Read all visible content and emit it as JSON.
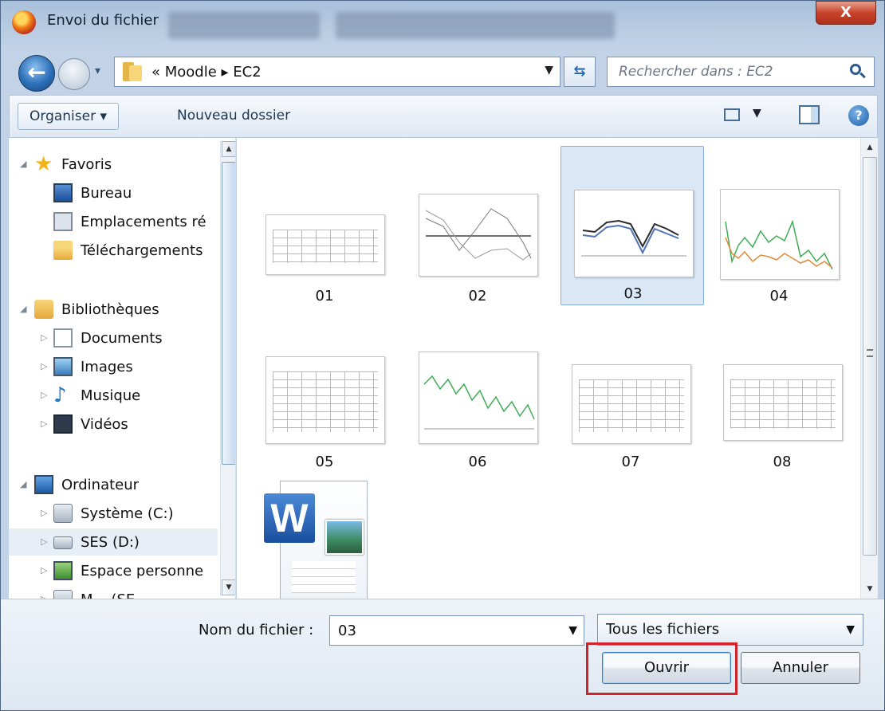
{
  "window": {
    "title": "Envoi du fichier",
    "close": "X"
  },
  "nav": {
    "back_glyph": "←",
    "history_glyph": "▾",
    "address": "«  Moodle  ▸  EC2",
    "address_drop": "▼",
    "refresh_glyph": "⇆",
    "search_placeholder": "Rechercher dans : EC2"
  },
  "toolbar": {
    "organize": "Organiser ▾",
    "new_folder": "Nouveau dossier",
    "view_drop": "▼",
    "help": "?"
  },
  "sidebar": {
    "favorites": {
      "label": "Favoris",
      "items": [
        {
          "label": "Bureau",
          "icon": "desktop-icon"
        },
        {
          "label": "Emplacements ré",
          "icon": "places-icon"
        },
        {
          "label": "Téléchargements",
          "icon": "downloads-icon"
        }
      ]
    },
    "libraries": {
      "label": "Bibliothèques",
      "items": [
        {
          "label": "Documents",
          "icon": "documents-icon"
        },
        {
          "label": "Images",
          "icon": "images-icon"
        },
        {
          "label": "Musique",
          "icon": "music-icon"
        },
        {
          "label": "Vidéos",
          "icon": "videos-icon"
        }
      ]
    },
    "computer": {
      "label": "Ordinateur",
      "items": [
        {
          "label": "Système (C:)",
          "icon": "system-drive-icon"
        },
        {
          "label": "SES (D:)",
          "icon": "drive-icon",
          "selected": true
        },
        {
          "label": "Espace personne",
          "icon": "network-drive-icon"
        },
        {
          "label": "M... (SE...",
          "icon": "network-drive-icon"
        }
      ]
    }
  },
  "files": [
    {
      "name": "01",
      "kind": "table"
    },
    {
      "name": "02",
      "kind": "chart"
    },
    {
      "name": "03",
      "kind": "chart",
      "selected": true
    },
    {
      "name": "04",
      "kind": "chart"
    },
    {
      "name": "05",
      "kind": "table"
    },
    {
      "name": "06",
      "kind": "chart"
    },
    {
      "name": "07",
      "kind": "table"
    },
    {
      "name": "08",
      "kind": "table"
    },
    {
      "name": "",
      "kind": "word-document"
    }
  ],
  "footer": {
    "filename_label": "Nom du fichier :",
    "filename_value": "03",
    "filter_value": "Tous les fichiers",
    "open_label": "Ouvrir",
    "cancel_label": "Annuler"
  },
  "colors": {
    "highlight": "#d2232a",
    "selection": "#d9e7f6"
  }
}
